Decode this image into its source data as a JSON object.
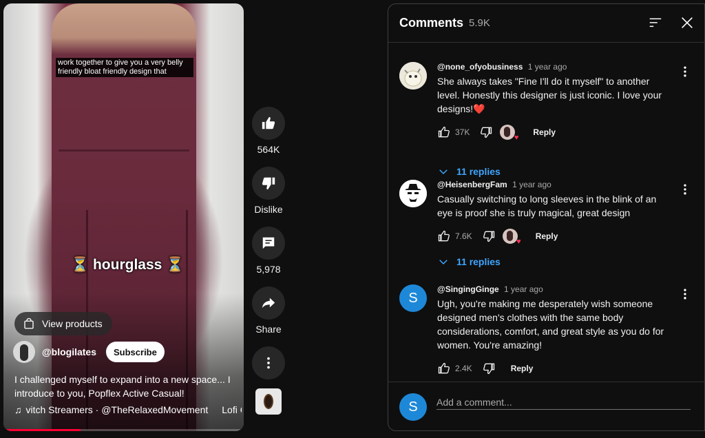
{
  "video": {
    "caption_top": "work together to give you a very belly friendly bloat friendly design that",
    "caption_mid": "⏳ hourglass ⏳",
    "view_products": "View products",
    "channel": "@blogilates",
    "subscribe": "Subscribe",
    "description": "I challenged myself to expand into a new space... I introduce to you, Popflex Active Casual!",
    "music_text": "vitch Streamers · @TheRelaxedMovement",
    "music_extra": "Lofi C",
    "progress": 0.32,
    "progress_color": "#ff0033"
  },
  "actions": {
    "like_count": "564K",
    "dislike_label": "Dislike",
    "comments_count": "5,978",
    "share_label": "Share"
  },
  "comments": {
    "title": "Comments",
    "count": "5.9K",
    "items": [
      {
        "author": "@none_ofyobusiness",
        "time": "1 year ago",
        "text": "She always takes \"Fine I'll do it myself\" to another level. Honestly this designer is just iconic. I love your designs!❤️",
        "likes": "37K",
        "reply": "Reply",
        "replies": "11 replies"
      },
      {
        "author": "@HeisenbergFam",
        "time": "1 year ago",
        "text": "Casually switching to long sleeves in the blink of an eye is proof she is truly magical, great design",
        "likes": "7.6K",
        "reply": "Reply",
        "replies": "11 replies"
      },
      {
        "author": "@SingingGinge",
        "avatar_letter": "S",
        "time": "1 year ago",
        "text": "Ugh, you're making me desperately wish someone designed men's clothes with the same body considerations, comfort, and great style as you do for women. You're amazing!",
        "likes": "2.4K",
        "reply": "Reply"
      }
    ],
    "footer": {
      "avatar_letter": "S",
      "placeholder": "Add a comment..."
    }
  },
  "colors": {
    "background": "#0f0f0f",
    "link_blue": "#3ea6ff",
    "avatar_blue": "#1e88d8"
  }
}
